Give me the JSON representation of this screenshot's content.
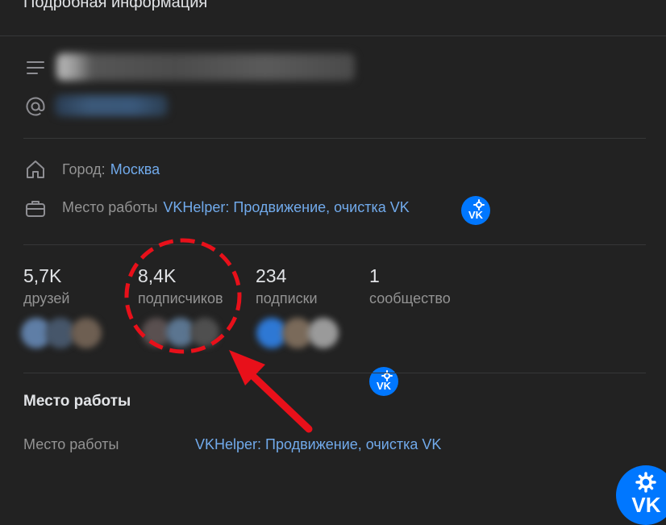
{
  "header": {
    "title": "Подробная информация"
  },
  "profile": {
    "status_icon": "menu-lines-icon",
    "domain_icon": "at-sign-icon"
  },
  "info": {
    "city_label": "Город:",
    "city_value": "Москва",
    "work_label": "Место работы",
    "work_value": "VKHelper: Продвижение, очистка VK"
  },
  "stats": [
    {
      "count": "5,7K",
      "label": "друзей"
    },
    {
      "count": "8,4K",
      "label": "подписчиков"
    },
    {
      "count": "234",
      "label": "подписки"
    },
    {
      "count": "1",
      "label": "сообщество"
    }
  ],
  "career": {
    "section_title": "Место работы",
    "label": "Место работы",
    "value": "VKHelper: Продвижение, очистка VK"
  },
  "badge": {
    "text": "VK"
  },
  "colors": {
    "background": "#222222",
    "link": "#71aaeb",
    "muted": "#939393",
    "vk_blue": "#0077ff",
    "annotation_red": "#e8101a"
  }
}
